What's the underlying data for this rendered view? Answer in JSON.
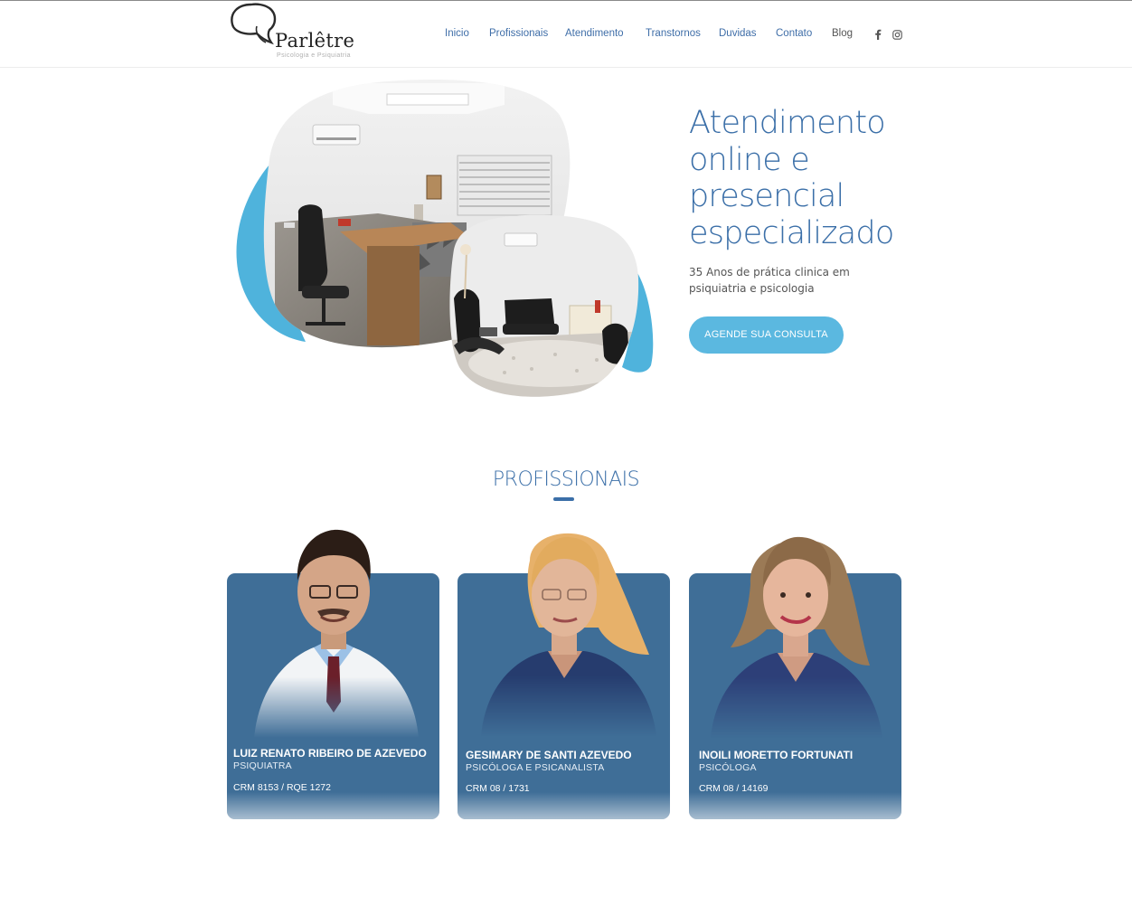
{
  "brand": {
    "name": "Parlêtre",
    "tagline": "Psicologia e Psiquiatria"
  },
  "nav": {
    "items": [
      {
        "label": "Inicio"
      },
      {
        "label": "Profissionais"
      },
      {
        "label": "Atendimento"
      },
      {
        "label": "Transtornos"
      },
      {
        "label": "Duvidas"
      },
      {
        "label": "Contato"
      },
      {
        "label": "Blog"
      }
    ],
    "social": [
      {
        "icon": "facebook-icon"
      },
      {
        "icon": "instagram-icon"
      }
    ]
  },
  "hero": {
    "title_lines": [
      "Atendimento",
      "online e",
      "presencial",
      "especializado"
    ],
    "subtitle": "35 Anos de prática clinica em psiquiatria e psicologia",
    "cta_label": "AGENDE SUA CONSULTA"
  },
  "professionals": {
    "heading": "PROFISSIONAIS",
    "cards": [
      {
        "name": "LUIZ RENATO RIBEIRO DE AZEVEDO",
        "role": "PSIQUIATRA",
        "registry": "CRM 8153 / RQE 1272"
      },
      {
        "name": "GESIMARY DE SANTI AZEVEDO",
        "role": "PSICÓLOGA E PSICANALISTA",
        "registry": "CRM 08 / 1731"
      },
      {
        "name": "INOILI MORETTO FORTUNATI",
        "role": "PSICÓLOGA",
        "registry": "CRM 08 / 14169"
      }
    ]
  },
  "colors": {
    "brand_blue": "#3b6fa8",
    "accent_cyan": "#5bb8e0",
    "card_blue": "#3f6e97"
  }
}
